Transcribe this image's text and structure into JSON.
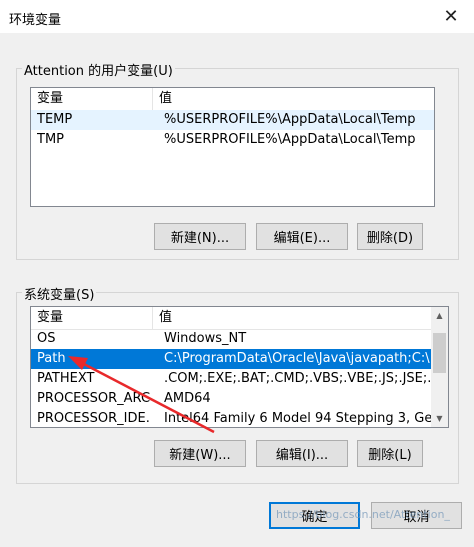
{
  "window": {
    "title": "环境变量",
    "close_glyph": "✕"
  },
  "user_vars": {
    "group_label": "Attention 的用户变量(U)",
    "columns": [
      "变量",
      "值"
    ],
    "rows": [
      {
        "name": "TEMP",
        "value": "%USERPROFILE%\\AppData\\Local\\Temp"
      },
      {
        "name": "TMP",
        "value": "%USERPROFILE%\\AppData\\Local\\Temp"
      }
    ],
    "buttons": {
      "new": "新建(N)...",
      "edit": "编辑(E)...",
      "delete": "删除(D)"
    }
  },
  "system_vars": {
    "group_label": "系统变量(S)",
    "columns": [
      "变量",
      "值"
    ],
    "rows": [
      {
        "name": "OS",
        "value": "Windows_NT"
      },
      {
        "name": "Path",
        "value": "C:\\ProgramData\\Oracle\\Java\\javapath;C:\\..."
      },
      {
        "name": "PATHEXT",
        "value": ".COM;.EXE;.BAT;.CMD;.VBS;.VBE;.JS;.JSE;.W..."
      },
      {
        "name": "PROCESSOR_ARC...",
        "value": "AMD64"
      },
      {
        "name": "PROCESSOR_IDE...",
        "value": "Intel64 Family 6 Model 94 Stepping 3, Ge..."
      }
    ],
    "selected_row": "Path",
    "buttons": {
      "new": "新建(W)...",
      "edit": "编辑(I)...",
      "delete": "删除(L)"
    }
  },
  "footer": {
    "ok": "确定",
    "cancel": "取消"
  },
  "watermark": "https://blog.csdn.net/Attention_",
  "colors": {
    "accent": "#0078d7",
    "annotation_arrow": "#e8292b"
  }
}
